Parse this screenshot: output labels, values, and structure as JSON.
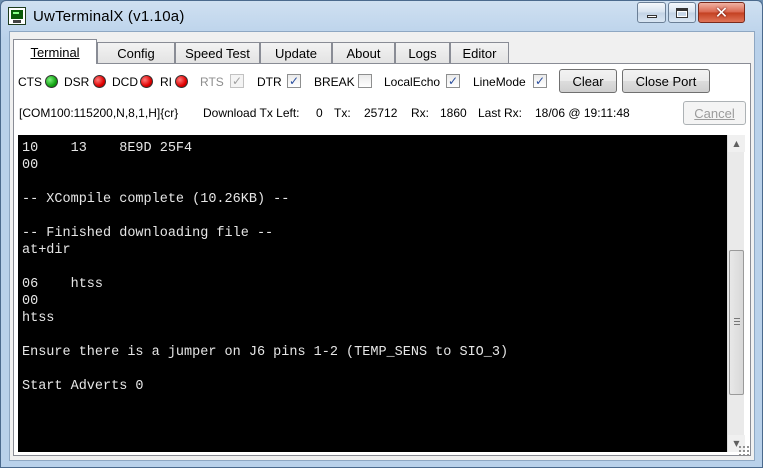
{
  "window": {
    "title": "UwTerminalX (v1.10a)"
  },
  "tabs": [
    {
      "label": "Terminal",
      "active": true
    },
    {
      "label": "Config"
    },
    {
      "label": "Speed Test"
    },
    {
      "label": "Update"
    },
    {
      "label": "About"
    },
    {
      "label": "Logs"
    },
    {
      "label": "Editor"
    }
  ],
  "signals": {
    "cts": {
      "label": "CTS",
      "state": "green"
    },
    "dsr": {
      "label": "DSR",
      "state": "red"
    },
    "dcd": {
      "label": "DCD",
      "state": "red"
    },
    "ri": {
      "label": "RI",
      "state": "red"
    }
  },
  "controls": {
    "rts": {
      "label": "RTS",
      "checked": true,
      "disabled": true
    },
    "dtr": {
      "label": "DTR",
      "checked": true
    },
    "break": {
      "label": "BREAK",
      "checked": false
    },
    "local_echo": {
      "label": "LocalEcho",
      "checked": true
    },
    "line_mode": {
      "label": "LineMode",
      "checked": true
    },
    "clear_button": "Clear",
    "close_port_button": "Close Port"
  },
  "status": {
    "port": "[COM100:115200,N,8,1,H]{cr}",
    "download_label": "Download Tx Left:",
    "download_value": "0",
    "tx_label": "Tx:",
    "tx_value": "25712",
    "rx_label": "Rx:",
    "rx_value": "1860",
    "last_rx_label": "Last Rx:",
    "last_rx_value": "18/06 @ 19:11:48",
    "cancel_button": "Cancel"
  },
  "terminal": {
    "text": "10    13    8E9D 25F4\n00\n\n-- XCompile complete (10.26KB) --\n\n-- Finished downloading file --\nat+dir\n\n06    htss\n00\nhtss\n\nEnsure there is a jumper on J6 pins 1-2 (TEMP_SENS to SIO_3)\n\nStart Adverts 0"
  },
  "icons": {
    "app": "terminal-app-icon",
    "minimize": "minimize-icon",
    "maximize": "maximize-icon",
    "close": "close-icon"
  }
}
